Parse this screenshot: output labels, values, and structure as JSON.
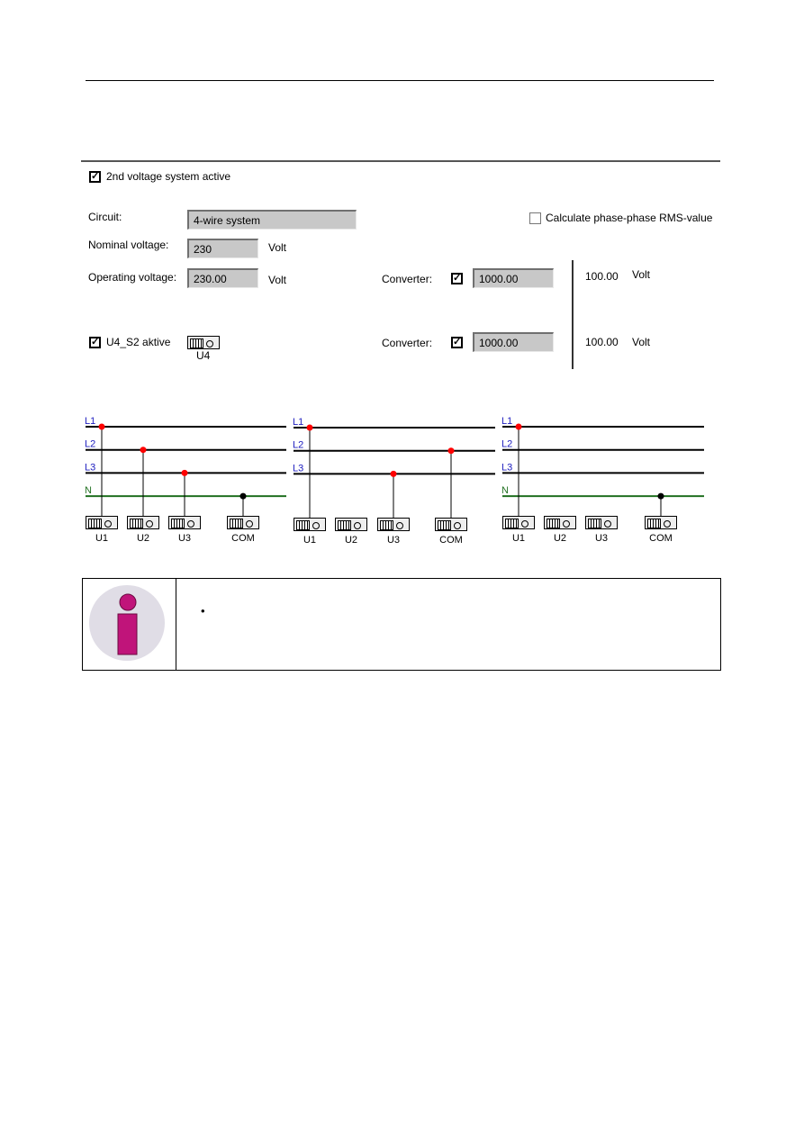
{
  "settings": {
    "second_system": {
      "label": "2nd voltage system active",
      "checked": true
    },
    "circuit": {
      "label": "Circuit:",
      "value": "4-wire system"
    },
    "rms": {
      "label": "Calculate phase-phase RMS-value",
      "checked": false
    },
    "nominal": {
      "label": "Nominal voltage:",
      "value": "230",
      "unit": "Volt"
    },
    "operating": {
      "label": "Operating voltage:",
      "value": "230.00",
      "unit": "Volt"
    },
    "converter1": {
      "label": "Converter:",
      "checked": true,
      "value": "1000.00",
      "secondary": "100.00",
      "unit": "Volt"
    },
    "u4": {
      "label": "U4_S2 aktive",
      "checked": true,
      "terminal": "U4"
    },
    "converter2": {
      "label": "Converter:",
      "checked": true,
      "value": "1000.00",
      "secondary": "100.00",
      "unit": "Volt"
    }
  },
  "diagrams": [
    {
      "lines": [
        "L1",
        "L2",
        "L3",
        "N"
      ],
      "terminals": [
        "U1",
        "U2",
        "U3",
        "COM"
      ],
      "connections": {
        "U1": "L1",
        "U2": "L2",
        "U3": "L3",
        "COM": "N"
      }
    },
    {
      "lines": [
        "L1",
        "L2",
        "L3"
      ],
      "terminals": [
        "U1",
        "U2",
        "U3",
        "COM"
      ],
      "connections": {
        "U1": "L1",
        "U3": "L3",
        "COM": "L2"
      }
    },
    {
      "lines": [
        "L1",
        "L2",
        "L3",
        "N"
      ],
      "terminals": [
        "U1",
        "U2",
        "U3",
        "COM"
      ],
      "connections": {
        "U1": "L1",
        "COM": "N"
      }
    }
  ],
  "colors": {
    "phase_label": "#2020c0",
    "neutral": "#207020",
    "phase_dot": "#ff0000",
    "neutral_dot": "#000000",
    "info_icon": "#c0147a"
  },
  "note": {
    "icon": "info-icon",
    "bullet": "•"
  }
}
